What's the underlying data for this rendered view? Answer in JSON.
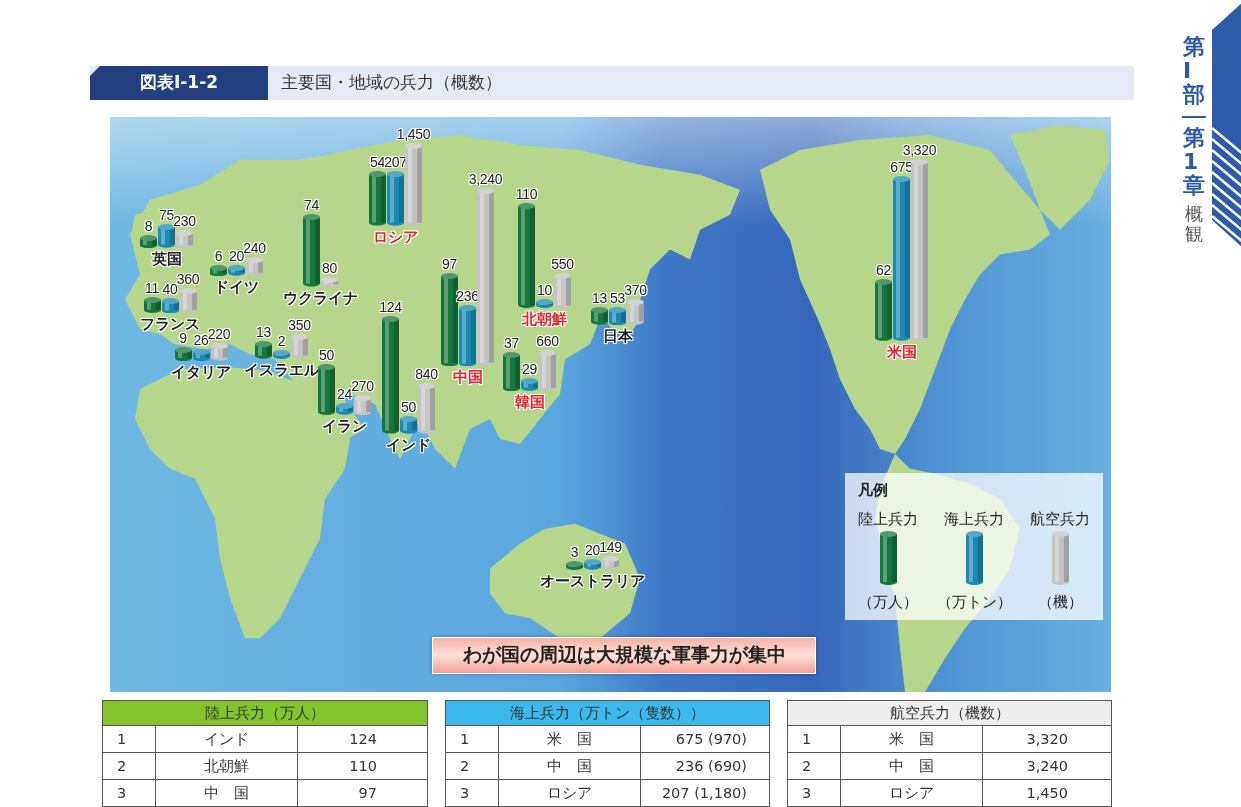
{
  "side_tab": {
    "part": "第Ⅰ部",
    "chapter": "第1章",
    "title": "概観"
  },
  "figure": {
    "number": "図表Ⅰ-1-2",
    "title": "主要国・地域の兵力（概数）"
  },
  "map": {
    "countries": [
      {
        "name": "英国",
        "color": "#1e1e1e",
        "land": "8",
        "sea": "75",
        "air": "230"
      },
      {
        "name": "ドイツ",
        "color": "#1e1e1e",
        "land": "6",
        "sea": "20",
        "air": "240"
      },
      {
        "name": "ウクライナ",
        "color": "#1e1e1e",
        "land": "74",
        "air": "80"
      },
      {
        "name": "ロシア",
        "color": "#e3262d",
        "land": "54",
        "sea": "207",
        "air": "1,450"
      },
      {
        "name": "フランス",
        "color": "#1e1e1e",
        "land": "11",
        "sea": "40",
        "air": "360"
      },
      {
        "name": "イタリア",
        "color": "#1e1e1e",
        "land": "9",
        "sea": "26",
        "air": "220"
      },
      {
        "name": "イスラエル",
        "color": "#1e1e1e",
        "land": "13",
        "sea": "2",
        "air": "350"
      },
      {
        "name": "イラン",
        "color": "#1e1e1e",
        "land": "50",
        "sea": "24",
        "air": "270"
      },
      {
        "name": "インド",
        "color": "#1e1e1e",
        "land": "124",
        "sea": "50",
        "air": "840"
      },
      {
        "name": "中国",
        "color": "#e3262d",
        "land": "97",
        "sea": "236",
        "air": "3,240"
      },
      {
        "name": "北朝鮮",
        "color": "#e3262d",
        "land": "110",
        "sea": "10",
        "air": "550"
      },
      {
        "name": "韓国",
        "color": "#e3262d",
        "land": "37",
        "sea": "29",
        "air": "660"
      },
      {
        "name": "日本",
        "color": "#1e1e1e",
        "land": "13",
        "sea": "53",
        "air": "370"
      },
      {
        "name": "米国",
        "color": "#e3262d",
        "land": "62",
        "sea": "675",
        "air": "3,320"
      },
      {
        "name": "オーストラリア",
        "color": "#1e1e1e",
        "land": "3",
        "sea": "20",
        "air": "149"
      }
    ],
    "legend": {
      "title": "凡例",
      "items": [
        {
          "label": "陸上兵力",
          "unit": "（万人）",
          "color": "#17763c"
        },
        {
          "label": "海上兵力",
          "unit": "（万トン）",
          "color": "#1a8ab5"
        },
        {
          "label": "航空兵力",
          "unit": "（機）",
          "color": "#c4c4c4"
        }
      ]
    },
    "banner": "わが国の周辺は大規模な軍事力が集中"
  },
  "tables": [
    {
      "heading": "陸上兵力（万人）",
      "color": "#84c42b",
      "rows": [
        {
          "rank": "1",
          "name": "インド",
          "value": "124"
        },
        {
          "rank": "2",
          "name": "北朝鮮",
          "value": "110"
        },
        {
          "rank": "3",
          "name": "中　国",
          "value": "97"
        }
      ]
    },
    {
      "heading": "海上兵力（万トン（隻数））",
      "color": "#3bb9ec",
      "rows": [
        {
          "rank": "1",
          "name": "米　国",
          "value": "675 (970)"
        },
        {
          "rank": "2",
          "name": "中　国",
          "value": "236 (690)"
        },
        {
          "rank": "3",
          "name": "ロシア",
          "value": "207 (1,180)"
        }
      ]
    },
    {
      "heading": "航空兵力（機数）",
      "color": "#eeeeee",
      "rows": [
        {
          "rank": "1",
          "name": "米　国",
          "value": "3,320"
        },
        {
          "rank": "2",
          "name": "中　国",
          "value": "3,240"
        },
        {
          "rank": "3",
          "name": "ロシア",
          "value": "1,450"
        }
      ]
    }
  ]
}
